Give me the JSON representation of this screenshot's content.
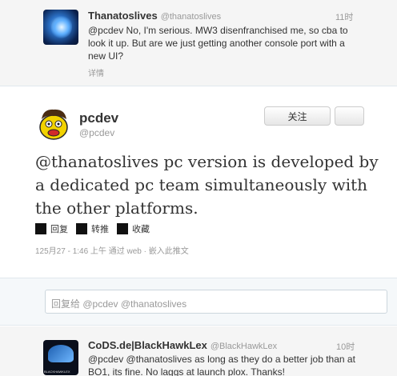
{
  "tweet_top": {
    "full_name": "Thanatoslives",
    "screen_name": "@thanatoslives",
    "time": "11时",
    "text": "@pcdev No, I'm serious. MW3 disenfranchised me, so cba to look it up. But are we just getting another console port with a new UI?",
    "details": "详情"
  },
  "main_tweet": {
    "full_name": "pcdev",
    "screen_name": "@pcdev",
    "follow_label": "关注",
    "text": "@thanatoslives pc version is developed by a dedicated pc team simultaneously with the other platforms.",
    "actions": {
      "reply": "回复",
      "retweet": "转推",
      "favorite": "收藏"
    },
    "meta": "125月27 - 1:46 上午 通过 web · 嵌入此推文"
  },
  "reply": {
    "placeholder": "回复给 @pcdev @thanatoslives"
  },
  "tweet_bottom": {
    "full_name": "CoDS.de|BlackHawkLex",
    "screen_name": "@BlackHawkLex",
    "time": "10时",
    "text": "@pcdev @thanatoslives as long as they do a better job than at BO1, its fine. No laggs at launch plox. Thanks!",
    "avatar_label": "BLACKHAWKLEX"
  }
}
